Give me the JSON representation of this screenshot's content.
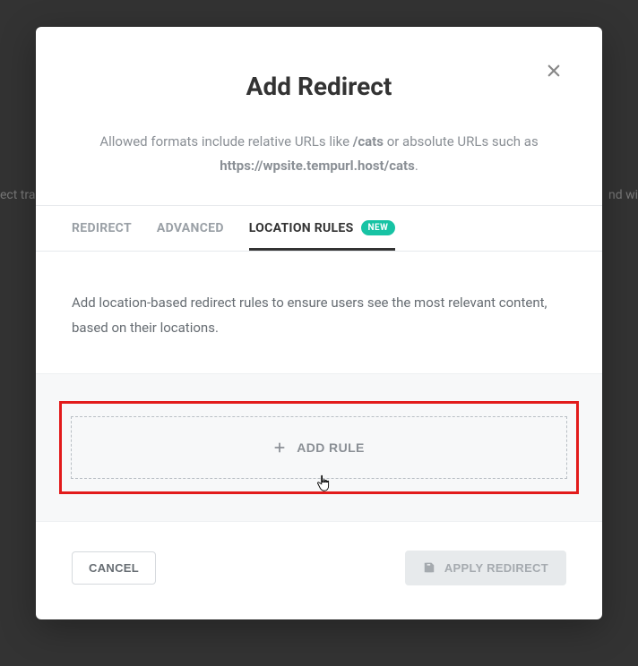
{
  "backdrop": {
    "left_fragment": "ect tra",
    "right_fragment": "nd wi"
  },
  "modal": {
    "title": "Add Redirect",
    "description_pre": "Allowed formats include relative URLs like ",
    "description_bold1": "/cats",
    "description_mid": " or absolute URLs such as ",
    "description_bold2": "https://wpsite.tempurl.host/cats",
    "description_post": "."
  },
  "tabs": {
    "redirect": "REDIRECT",
    "advanced": "ADVANCED",
    "location_rules": "LOCATION RULES",
    "badge": "NEW"
  },
  "body": {
    "text": "Add location-based redirect rules to ensure users see the most relevant content, based on their locations."
  },
  "rule": {
    "add_label": "ADD RULE"
  },
  "footer": {
    "cancel": "CANCEL",
    "apply": "APPLY REDIRECT"
  }
}
